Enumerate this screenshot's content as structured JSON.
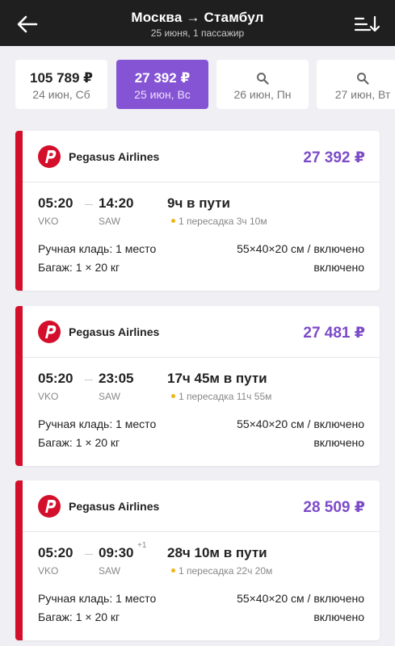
{
  "header": {
    "route": "Москва → Стамбул",
    "subtitle": "25 июня, 1 пассажир",
    "back_icon": "arrow-left-icon",
    "sort_icon": "sort-icon"
  },
  "dates": [
    {
      "price": "105 789 ₽",
      "label": "24 июн, Сб",
      "selected": false
    },
    {
      "price": "27 392 ₽",
      "label": "25 июн, Вс",
      "selected": true
    },
    {
      "price": "",
      "label": "26 июн, Пн",
      "icon": "search-icon",
      "selected": false
    },
    {
      "price": "",
      "label": "27 июн, Вт",
      "icon": "search-icon",
      "selected": false
    }
  ],
  "flights": [
    {
      "airline": "Pegasus Airlines",
      "price": "27 392 ₽",
      "dep_time": "05:20",
      "dep_code": "VKO",
      "arr_time": "14:20",
      "arr_code": "SAW",
      "arr_day_offset": "",
      "duration": "9ч в пути",
      "stops": "1 пересадка 3ч 10м",
      "hand_label": "Ручная кладь: 1 место",
      "hand_value": "55×40×20 см / включено",
      "bag_label": "Багаж: 1 × 20 кг",
      "bag_value": "включено"
    },
    {
      "airline": "Pegasus Airlines",
      "price": "27 481 ₽",
      "dep_time": "05:20",
      "dep_code": "VKO",
      "arr_time": "23:05",
      "arr_code": "SAW",
      "arr_day_offset": "",
      "duration": "17ч 45м в пути",
      "stops": "1 пересадка 11ч 55м",
      "hand_label": "Ручная кладь: 1 место",
      "hand_value": "55×40×20 см / включено",
      "bag_label": "Багаж: 1 × 20 кг",
      "bag_value": "включено"
    },
    {
      "airline": "Pegasus Airlines",
      "price": "28 509 ₽",
      "dep_time": "05:20",
      "dep_code": "VKO",
      "arr_time": "09:30",
      "arr_code": "SAW",
      "arr_day_offset": "+1",
      "duration": "28ч 10м в пути",
      "stops": "1 пересадка 22ч 20м",
      "hand_label": "Ручная кладь: 1 место",
      "hand_value": "55×40×20 см / включено",
      "bag_label": "Багаж: 1 × 20 кг",
      "bag_value": "включено"
    }
  ],
  "colors": {
    "header_bg": "#1f1f1f",
    "accent_purple": "#8554d4",
    "price_purple": "#7d4cc8",
    "airline_red": "#d40f2b",
    "stop_dot": "#f2b318"
  }
}
